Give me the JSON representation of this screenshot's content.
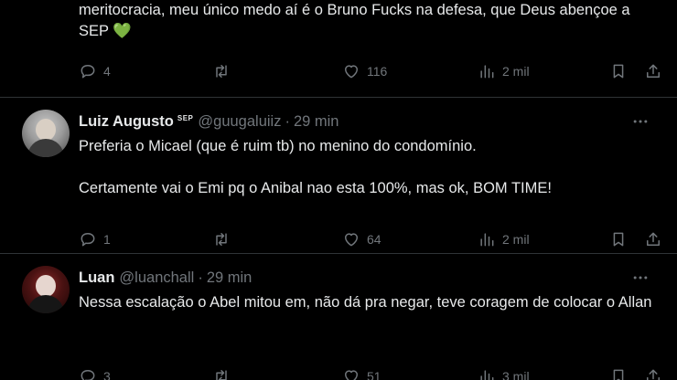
{
  "tweets": [
    {
      "text": "meritocracia, meu único medo aí é o Bruno Fucks na defesa, que Deus abençoe a SEP",
      "emoji": "💚",
      "replies": "4",
      "retweets": "",
      "likes": "116",
      "views": "2 mil"
    },
    {
      "name": "Luiz Augusto",
      "badge": "SEP",
      "handle": "@guugaluiiz",
      "separator": "·",
      "time": "29 min",
      "text": "Preferia o Micael (que é ruim tb) no menino do condomínio.\n\nCertamente vai o Emi pq o Anibal nao esta 100%, mas ok, BOM TIME!",
      "replies": "1",
      "retweets": "",
      "likes": "64",
      "views": "2 mil"
    },
    {
      "name": "Luan",
      "handle": "@luanchall",
      "separator": "·",
      "time": "29 min",
      "text": "Nessa escalação o Abel mitou em, não dá pra negar, teve coragem de colocar o Allan",
      "replies": "3",
      "retweets": "",
      "likes": "51",
      "views": "3 mil"
    }
  ],
  "icons": {
    "reply": "reply-icon",
    "retweet": "retweet-icon",
    "like": "heart-icon",
    "views": "views-icon",
    "bookmark": "bookmark-icon",
    "share": "share-icon",
    "more": "more-icon"
  },
  "colors": {
    "background": "#000000",
    "text": "#e7e9ea",
    "muted": "#71767b",
    "divider": "#2f3336",
    "green_heart": "#63c64f"
  }
}
